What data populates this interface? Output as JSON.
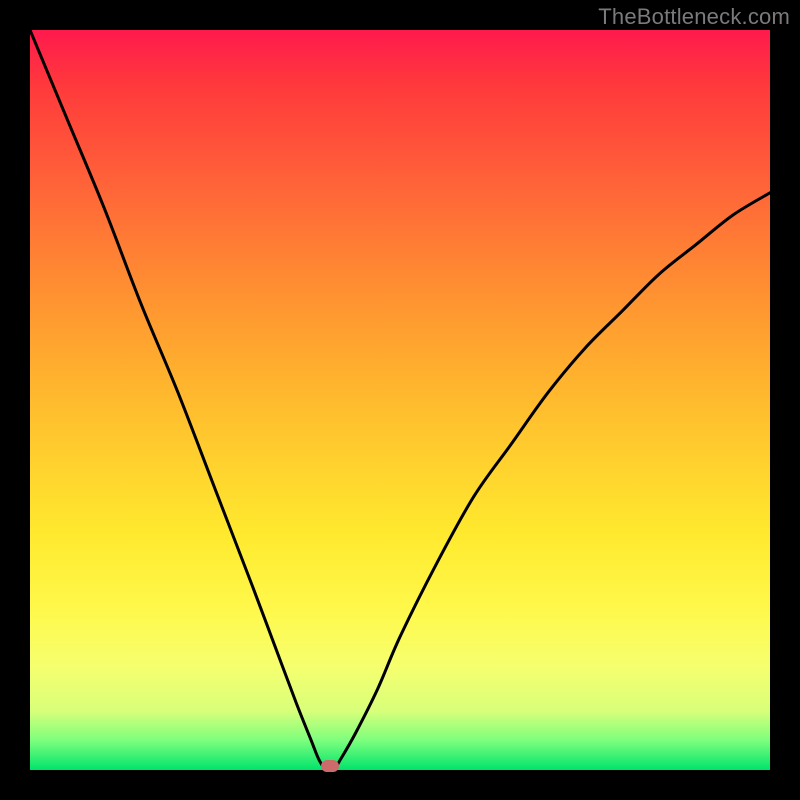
{
  "watermark": "TheBottleneck.com",
  "colors": {
    "curve": "#000000",
    "marker": "#cc6b6b",
    "frame": "#000000"
  },
  "chart_data": {
    "type": "line",
    "title": "",
    "xlabel": "",
    "ylabel": "",
    "xlim": [
      0,
      100
    ],
    "ylim": [
      0,
      100
    ],
    "grid": false,
    "legend": false,
    "series": [
      {
        "name": "bottleneck-curve",
        "x": [
          0,
          5,
          10,
          15,
          20,
          25,
          30,
          33,
          36,
          38,
          39,
          40,
          41,
          42,
          44,
          47,
          50,
          55,
          60,
          65,
          70,
          75,
          80,
          85,
          90,
          95,
          100
        ],
        "y": [
          100,
          88,
          76,
          63,
          51,
          38,
          25,
          17,
          9,
          4,
          1.5,
          0,
          0,
          1.5,
          5,
          11,
          18,
          28,
          37,
          44,
          51,
          57,
          62,
          67,
          71,
          75,
          78
        ]
      }
    ],
    "annotations": [
      {
        "name": "optimal-marker",
        "x": 40.5,
        "y": 0
      }
    ],
    "gradient_stops": [
      {
        "pos": 0,
        "color": "#ff1a4d"
      },
      {
        "pos": 50,
        "color": "#ffd02e"
      },
      {
        "pos": 100,
        "color": "#00e36b"
      }
    ]
  }
}
